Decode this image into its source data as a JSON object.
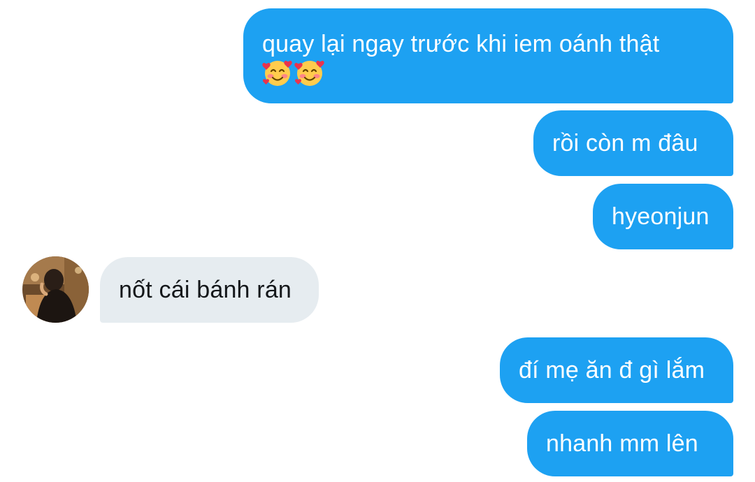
{
  "conversation": {
    "messages": [
      {
        "sender": "me",
        "text": "quay lại ngay trước khi iem oánh thật",
        "emoji": [
          "smiling-face-with-hearts",
          "smiling-face-with-hearts"
        ]
      },
      {
        "sender": "me",
        "text": "rồi còn m đâu"
      },
      {
        "sender": "me",
        "text": "hyeonjun"
      },
      {
        "sender": "other",
        "text": "nốt cái bánh rán"
      },
      {
        "sender": "me",
        "text": "đí mẹ ăn đ gì lắm"
      },
      {
        "sender": "me",
        "text": "nhanh mm lên"
      }
    ]
  },
  "colors": {
    "sent_bubble": "#1da1f2",
    "sent_text": "#ffffff",
    "received_bubble": "#e6ecf0",
    "received_text": "#14171a"
  }
}
